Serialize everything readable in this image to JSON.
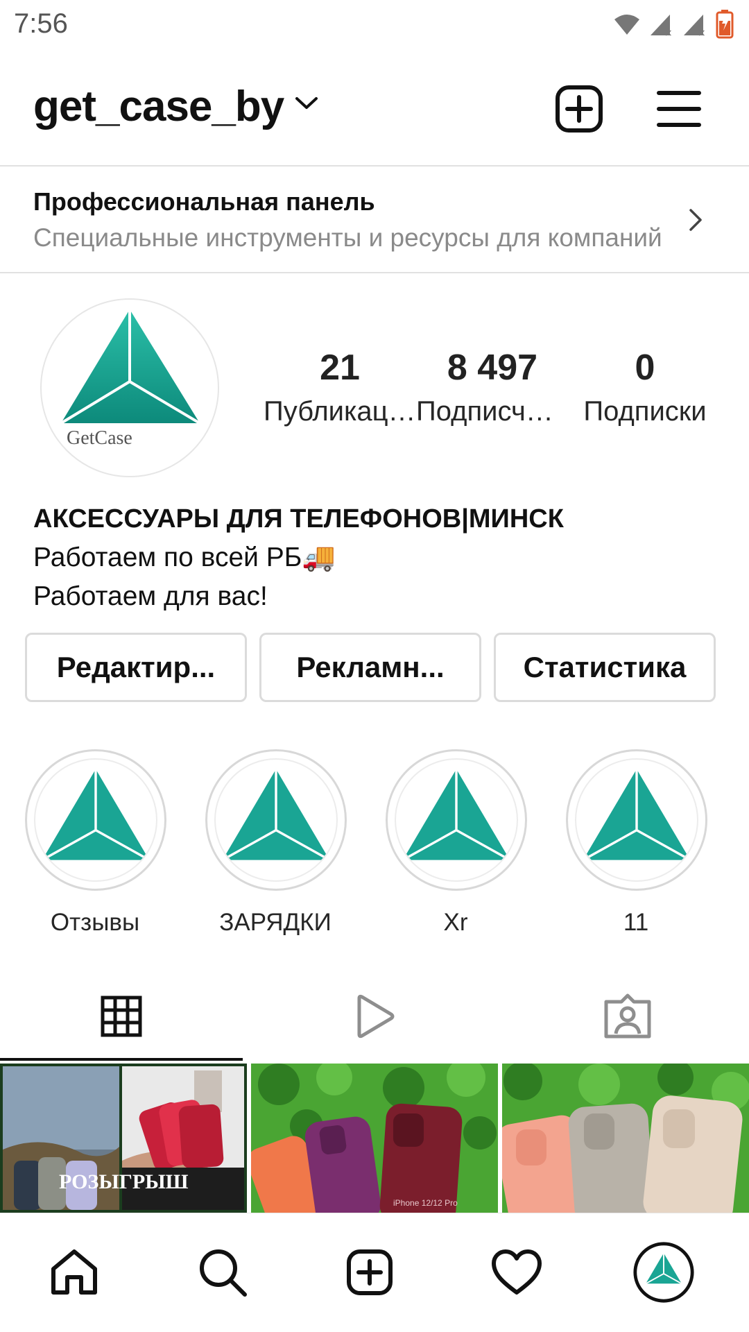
{
  "status_bar": {
    "time": "7:56",
    "icons": [
      "wifi-icon",
      "signal-icon",
      "signal-icon",
      "battery-icon"
    ]
  },
  "header": {
    "username": "get_case_by"
  },
  "pro_panel": {
    "title": "Профессиональная панель",
    "subtitle": "Специальные инструменты и ресурсы для компаний"
  },
  "profile": {
    "avatar_text": "GetCase",
    "stats": [
      {
        "value": "21",
        "label": "Публикации"
      },
      {
        "value": "8 497",
        "label": "Подписчики"
      },
      {
        "value": "0",
        "label": "Подписки"
      }
    ]
  },
  "bio": {
    "name": "АКСЕССУАРЫ ДЛЯ ТЕЛЕФОНОВ|МИНСК",
    "line1": "Работаем по всей РБ🚚",
    "line2": "Работаем для вас!"
  },
  "buttons": {
    "edit": "Редактир...",
    "ads": "Рекламн...",
    "stats": "Статистика"
  },
  "highlights": [
    {
      "label": "Отзывы"
    },
    {
      "label": "ЗАРЯДКИ"
    },
    {
      "label": "Xr"
    },
    {
      "label": "11"
    }
  ],
  "posts": [
    {
      "caption": "РОЗЫГРЫШ"
    },
    {
      "caption": "iPhone 12/12 Pro"
    },
    {
      "caption": ""
    }
  ],
  "colors": {
    "brand_teal": "#1aa594",
    "brand_teal_dark": "#0e8c7c",
    "grass_green": "#3f9a2c"
  }
}
